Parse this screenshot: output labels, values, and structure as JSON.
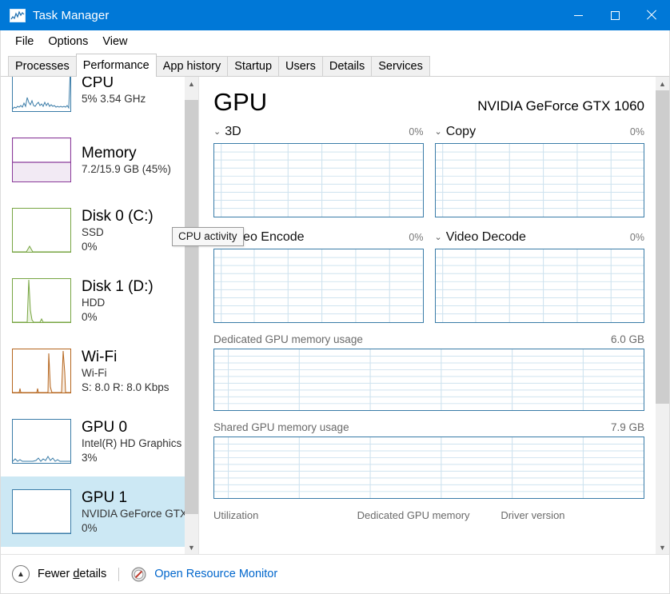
{
  "window": {
    "title": "Task Manager",
    "icon": "task-manager-icon",
    "minimize_label": "Minimize",
    "maximize_label": "Maximize",
    "close_label": "Close"
  },
  "menu": {
    "items": [
      {
        "label": "File"
      },
      {
        "label": "Options"
      },
      {
        "label": "View"
      }
    ]
  },
  "tabs": {
    "active": "Performance",
    "items": [
      {
        "label": "Processes"
      },
      {
        "label": "Performance"
      },
      {
        "label": "App history"
      },
      {
        "label": "Startup"
      },
      {
        "label": "Users"
      },
      {
        "label": "Details"
      },
      {
        "label": "Services"
      }
    ]
  },
  "sidebar": {
    "items": [
      {
        "title": "CPU",
        "sub1": "5%  3.54 GHz",
        "sub2": "",
        "selected": false,
        "graph_color": "#3a7ca8",
        "graph_type": "line"
      },
      {
        "title": "Memory",
        "sub1": "7.2/15.9 GB (45%)",
        "sub2": "",
        "selected": false,
        "graph_color": "#8a3a9a",
        "graph_type": "fill",
        "fill_percent": 45
      },
      {
        "title": "Disk 0 (C:)",
        "sub1": "SSD",
        "sub2": "0%",
        "selected": false,
        "graph_color": "#77a542",
        "graph_type": "line"
      },
      {
        "title": "Disk 1 (D:)",
        "sub1": "HDD",
        "sub2": "0%",
        "selected": false,
        "graph_color": "#77a542",
        "graph_type": "spike"
      },
      {
        "title": "Wi-Fi",
        "sub1": "Wi-Fi",
        "sub2": "S: 8.0 R: 8.0 Kbps",
        "selected": false,
        "graph_color": "#b5651d",
        "graph_type": "spike"
      },
      {
        "title": "GPU 0",
        "sub1": "Intel(R) HD Graphics",
        "sub2": "3%",
        "selected": false,
        "graph_color": "#3a7ca8",
        "graph_type": "line"
      },
      {
        "title": "GPU 1",
        "sub1": "NVIDIA GeForce GTX",
        "sub2": "0%",
        "selected": true,
        "graph_color": "#3a7ca8",
        "graph_type": "flat"
      }
    ]
  },
  "tooltip": {
    "text": "CPU activity"
  },
  "main": {
    "title": "GPU",
    "model": "NVIDIA GeForce GTX 1060",
    "engines": [
      {
        "label": "3D",
        "value": "0%"
      },
      {
        "label": "Copy",
        "value": "0%"
      },
      {
        "label": "Video Encode",
        "value": "0%"
      },
      {
        "label": "Video Decode",
        "value": "0%"
      }
    ],
    "memory": [
      {
        "label": "Dedicated GPU memory usage",
        "value": "6.0 GB"
      },
      {
        "label": "Shared GPU memory usage",
        "value": "7.9 GB"
      }
    ],
    "stats": [
      {
        "key": "Utilization"
      },
      {
        "key": "Dedicated GPU memory"
      },
      {
        "key": "Driver version"
      }
    ]
  },
  "statusbar": {
    "fewer_details_pre": "Fewer ",
    "fewer_details_underline": "d",
    "fewer_details_post": "etails",
    "resource_monitor": "Open Resource Monitor",
    "resource_icon": "resource-monitor-icon",
    "chevron": "chevron-up-icon"
  },
  "chart_data": [
    {
      "type": "line",
      "title": "3D",
      "ylim": [
        0,
        100
      ],
      "values": [
        0,
        0,
        0,
        0,
        0,
        0,
        0,
        0,
        0,
        0,
        0,
        0,
        0,
        0,
        0,
        0,
        0,
        0,
        0,
        0
      ],
      "grid": true,
      "grid_rows": 9,
      "grid_cols": 6,
      "current": "0%"
    },
    {
      "type": "line",
      "title": "Copy",
      "ylim": [
        0,
        100
      ],
      "values": [
        0,
        0,
        0,
        0,
        0,
        0,
        0,
        0,
        0,
        0,
        0,
        0,
        0,
        0,
        0,
        0,
        0,
        0,
        0,
        0
      ],
      "grid": true,
      "grid_rows": 9,
      "grid_cols": 6,
      "current": "0%"
    },
    {
      "type": "line",
      "title": "Video Encode",
      "ylim": [
        0,
        100
      ],
      "values": [
        0,
        0,
        0,
        0,
        0,
        0,
        0,
        0,
        0,
        0,
        0,
        0,
        0,
        0,
        0,
        0,
        0,
        0,
        0,
        0
      ],
      "grid": true,
      "grid_rows": 9,
      "grid_cols": 6,
      "current": "0%"
    },
    {
      "type": "line",
      "title": "Video Decode",
      "ylim": [
        0,
        100
      ],
      "values": [
        0,
        0,
        0,
        0,
        0,
        0,
        0,
        0,
        0,
        0,
        0,
        0,
        0,
        0,
        0,
        0,
        0,
        0,
        0,
        0
      ],
      "grid": true,
      "grid_rows": 9,
      "grid_cols": 6,
      "current": "0%"
    },
    {
      "type": "area",
      "title": "Dedicated GPU memory usage",
      "ylim": [
        0,
        6.0
      ],
      "ylabel": "GB",
      "values": [
        0,
        0,
        0,
        0,
        0,
        0,
        0,
        0,
        0,
        0,
        0,
        0,
        0,
        0,
        0,
        0,
        0,
        0,
        0,
        0
      ],
      "grid": true,
      "grid_rows": 8,
      "grid_cols": 5,
      "max_label": "6.0 GB"
    },
    {
      "type": "area",
      "title": "Shared GPU memory usage",
      "ylim": [
        0,
        7.9
      ],
      "ylabel": "GB",
      "values": [
        0,
        0,
        0,
        0,
        0,
        0,
        0,
        0,
        0,
        0,
        0,
        0,
        0,
        0,
        0,
        0,
        0,
        0,
        0,
        0
      ],
      "grid": true,
      "grid_rows": 8,
      "grid_cols": 5,
      "max_label": "7.9 GB"
    }
  ]
}
